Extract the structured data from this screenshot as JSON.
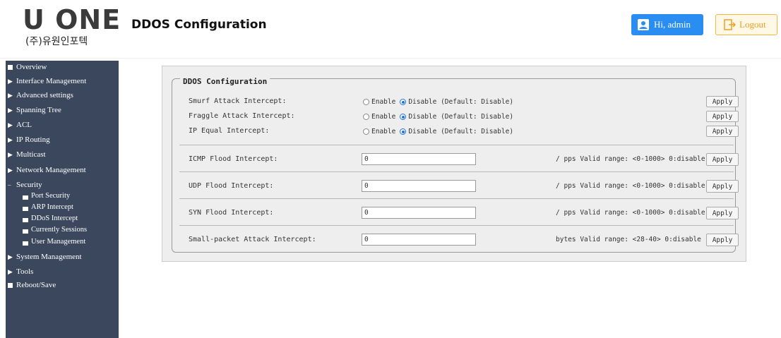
{
  "header": {
    "logo_main": "U ONE",
    "logo_sub": "(주)유원인포텍",
    "title": "DDOS Configuration",
    "user_label": "Hi, admin",
    "logout_label": "Logout"
  },
  "sidebar": {
    "items": [
      {
        "label": "Overview",
        "marker": "square"
      },
      {
        "label": "Interface Management",
        "marker": "arrow"
      },
      {
        "label": "Advanced settings",
        "marker": "arrow"
      },
      {
        "label": "Spanning Tree",
        "marker": "arrow"
      },
      {
        "label": "ACL",
        "marker": "arrow"
      },
      {
        "label": "IP Routing",
        "marker": "arrow"
      },
      {
        "label": "Multicast",
        "marker": "arrow"
      },
      {
        "label": "Network Management",
        "marker": "arrow"
      },
      {
        "label": "Security",
        "marker": "dash"
      },
      {
        "label": "System Management",
        "marker": "arrow"
      },
      {
        "label": "Tools",
        "marker": "arrow"
      },
      {
        "label": "Reboot/Save",
        "marker": "square"
      }
    ],
    "security_sub": [
      "Port Security",
      "ARP Intercept",
      "DDoS Intercept",
      "Currently Sessions",
      "User Management"
    ]
  },
  "form": {
    "legend": "DDOS Configuration",
    "radio_rows": [
      {
        "label": "Smurf Attack Intercept:",
        "enable": "Enable",
        "disable": "Disable (Default: Disable)",
        "selected": "disable",
        "apply": "Apply"
      },
      {
        "label": "Fraggle Attack Intercept:",
        "enable": "Enable",
        "disable": "Disable (Default: Disable)",
        "selected": "disable",
        "apply": "Apply"
      },
      {
        "label": "IP Equal Intercept:",
        "enable": "Enable",
        "disable": "Disable (Default: Disable)",
        "selected": "disable",
        "apply": "Apply"
      }
    ],
    "input_rows": [
      {
        "label": "ICMP Flood Intercept:",
        "value": "0",
        "hint": "/ pps Valid range: <0-1000> 0:disable",
        "apply": "Apply"
      },
      {
        "label": "UDP Flood Intercept:",
        "value": "0",
        "hint": "/ pps Valid range: <0-1000> 0:disable",
        "apply": "Apply"
      },
      {
        "label": "SYN Flood Intercept:",
        "value": "0",
        "hint": "/ pps Valid range: <0-1000> 0:disable",
        "apply": "Apply"
      },
      {
        "label": "Small-packet Attack Intercept:",
        "value": "0",
        "hint": "bytes Valid range: <28-40> 0:disable",
        "apply": "Apply"
      }
    ]
  },
  "colors": {
    "sidebar_bg": "#3a475d",
    "user_btn": "#2a8df2",
    "logout_border": "#f5b642",
    "radio_checked": "#1a73e8"
  }
}
